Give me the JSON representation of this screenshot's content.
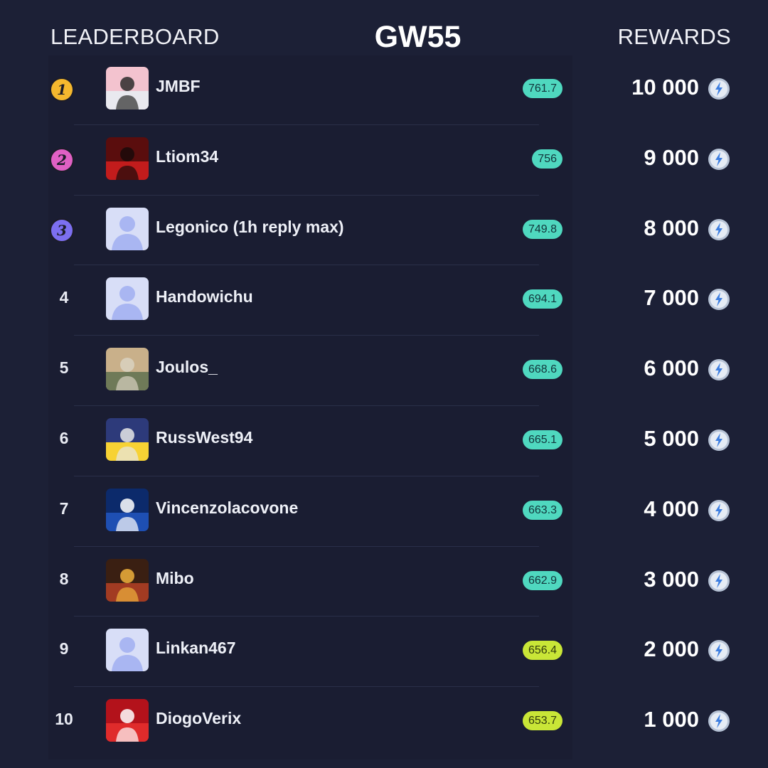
{
  "header": {
    "left": "LEADERBOARD",
    "center": "GW55",
    "right": "REWARDS"
  },
  "colors": {
    "background": "#1c2036",
    "score_teal": "#4fd8bf",
    "score_lime": "#c9e637",
    "gold": "#f5b82e",
    "pink": "#e060c4",
    "purple": "#7c6ff0"
  },
  "rows": [
    {
      "rank": "1",
      "medal": "gold",
      "avatar": "photo",
      "name": "JMBF",
      "score": "761.7",
      "score_color": "teal",
      "reward": "10 000"
    },
    {
      "rank": "2",
      "medal": "pink",
      "avatar": "photo",
      "name": "Ltiom34",
      "score": "756",
      "score_color": "teal",
      "reward": "9 000"
    },
    {
      "rank": "3",
      "medal": "purple",
      "avatar": "default",
      "name": "Legonico (1h reply max)",
      "score": "749.8",
      "score_color": "teal",
      "reward": "8 000"
    },
    {
      "rank": "4",
      "medal": "",
      "avatar": "default",
      "name": "Handowichu",
      "score": "694.1",
      "score_color": "teal",
      "reward": "7 000"
    },
    {
      "rank": "5",
      "medal": "",
      "avatar": "photo",
      "name": "Joulos_",
      "score": "668.6",
      "score_color": "teal",
      "reward": "6 000"
    },
    {
      "rank": "6",
      "medal": "",
      "avatar": "photo",
      "name": "RussWest94",
      "score": "665.1",
      "score_color": "teal",
      "reward": "5 000"
    },
    {
      "rank": "7",
      "medal": "",
      "avatar": "photo",
      "name": "Vincenzolacovone",
      "score": "663.3",
      "score_color": "teal",
      "reward": "4 000"
    },
    {
      "rank": "8",
      "medal": "",
      "avatar": "photo",
      "name": "Mibo",
      "score": "662.9",
      "score_color": "teal",
      "reward": "3 000"
    },
    {
      "rank": "9",
      "medal": "",
      "avatar": "default",
      "name": "Linkan467",
      "score": "656.4",
      "score_color": "lime",
      "reward": "2 000"
    },
    {
      "rank": "10",
      "medal": "",
      "avatar": "photo",
      "name": "DiogoVerix",
      "score": "653.7",
      "score_color": "lime",
      "reward": "1 000"
    }
  ],
  "icons": {
    "reward_currency": "coin-bolt-icon",
    "default_avatar": "person-silhouette-icon"
  }
}
